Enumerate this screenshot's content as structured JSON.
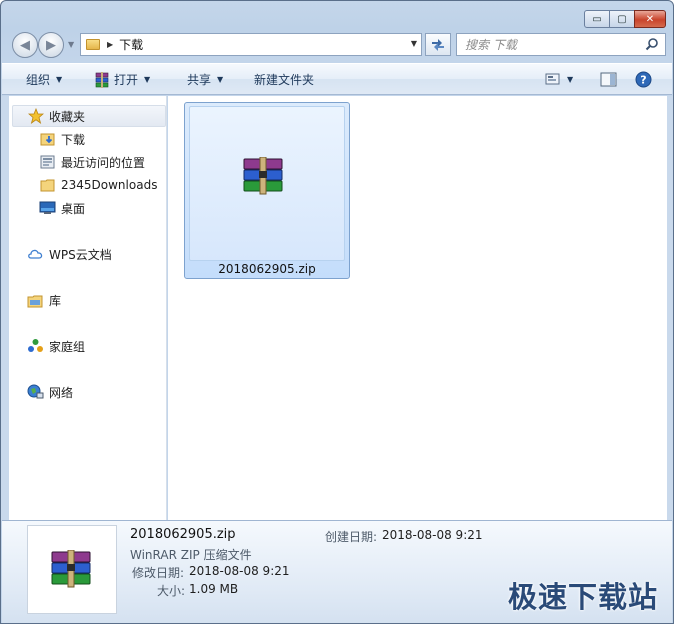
{
  "window": {
    "controls": {
      "minimize": "▭",
      "maximize": "▢",
      "close": "✕"
    }
  },
  "nav": {
    "back": "◀",
    "forward": "▶",
    "address_path": "下载",
    "search_placeholder": "搜索 下载"
  },
  "toolbar": {
    "organize": "组织",
    "open": "打开",
    "share": "共享",
    "new_folder": "新建文件夹"
  },
  "sidebar": {
    "items": [
      {
        "label": "收藏夹",
        "icon": "star-icon"
      },
      {
        "label": "下载",
        "icon": "downloads-folder-icon"
      },
      {
        "label": "最近访问的位置",
        "icon": "recent-places-icon"
      },
      {
        "label": "2345Downloads",
        "icon": "folder-icon"
      },
      {
        "label": "桌面",
        "icon": "desktop-icon"
      },
      {
        "label": "WPS云文档",
        "icon": "cloud-icon"
      },
      {
        "label": "库",
        "icon": "library-icon"
      },
      {
        "label": "家庭组",
        "icon": "homegroup-icon"
      },
      {
        "label": "网络",
        "icon": "network-icon"
      }
    ]
  },
  "files": [
    {
      "name": "2018062905.zip",
      "icon": "winrar-archive-icon",
      "selected": true
    }
  ],
  "details": {
    "filename": "2018062905.zip",
    "type": "WinRAR ZIP 压缩文件",
    "modified_label": "修改日期:",
    "modified_value": "2018-08-08 9:21",
    "size_label": "大小:",
    "size_value": "1.09 MB",
    "created_label": "创建日期:",
    "created_value": "2018-08-08 9:21"
  },
  "watermark": "极速下载站",
  "colors": {
    "accent": "#1e395b",
    "selection": "#c4ddfb",
    "frame": "#bed2e8"
  }
}
